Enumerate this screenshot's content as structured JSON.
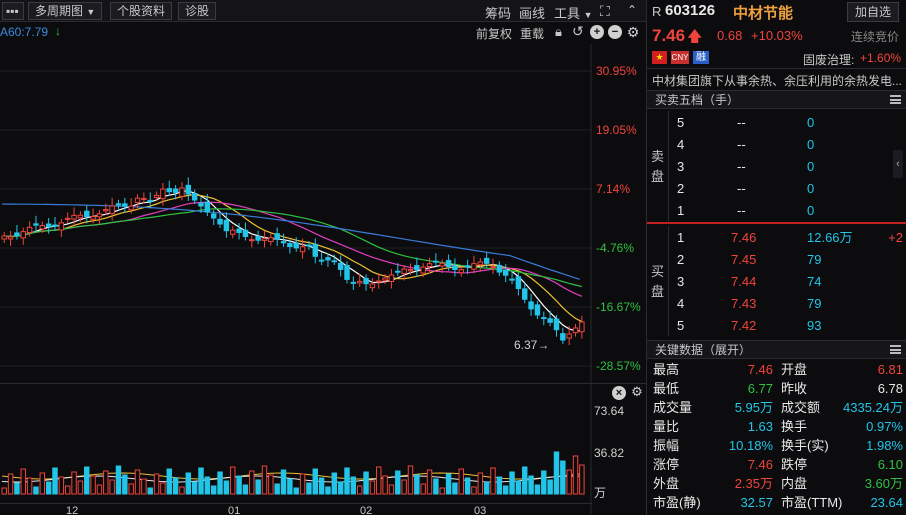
{
  "toolbar": {
    "period_label": "多周期图",
    "stock_info_label": "个股资料",
    "diagnose_label": "诊股",
    "chips_label": "筹码",
    "draw_label": "画线",
    "tools_label": "工具"
  },
  "ma_readout": "A60:7.79",
  "chart_controls": {
    "fq_label": "前复权",
    "overlay_label": "重载"
  },
  "price_axis": {
    "labels": [
      "30.95%",
      "19.05%",
      "7.14%",
      "-4.76%",
      "-16.67%",
      "-28.57%"
    ]
  },
  "min_marker": "6.37→",
  "volume_axis": {
    "labels": [
      "73.64",
      "36.82",
      "万"
    ]
  },
  "time_axis": {
    "labels": [
      "12",
      "01",
      "02",
      "03"
    ]
  },
  "stock": {
    "prefix": "R",
    "code": "603126",
    "name": "中材节能",
    "add_watch": "加自选",
    "price": "7.46",
    "change": "0.68",
    "change_pct": "+10.03%",
    "auction": "连续竞价",
    "badges": [
      "CNY",
      "融"
    ],
    "theme_label": "固废治理:",
    "theme_pct": "+1.60%",
    "description": "中材集团旗下从事余热、余压利用的余热发电..."
  },
  "order_book": {
    "title": "买卖五档（手）",
    "sell_label": "卖盘",
    "buy_label": "买盘",
    "sells": [
      {
        "level": "5",
        "price": "--",
        "vol": "0"
      },
      {
        "level": "4",
        "price": "--",
        "vol": "0"
      },
      {
        "level": "3",
        "price": "--",
        "vol": "0"
      },
      {
        "level": "2",
        "price": "--",
        "vol": "0"
      },
      {
        "level": "1",
        "price": "--",
        "vol": "0"
      }
    ],
    "buys": [
      {
        "level": "1",
        "price": "7.46",
        "vol": "12.66万",
        "delta": "+2"
      },
      {
        "level": "2",
        "price": "7.45",
        "vol": "79",
        "delta": ""
      },
      {
        "level": "3",
        "price": "7.44",
        "vol": "74",
        "delta": ""
      },
      {
        "level": "4",
        "price": "7.43",
        "vol": "79",
        "delta": ""
      },
      {
        "level": "5",
        "price": "7.42",
        "vol": "93",
        "delta": ""
      }
    ]
  },
  "key_data": {
    "title": "关键数据（展开）",
    "rows": [
      {
        "l1": "最高",
        "v1": "7.46",
        "l2": "开盘",
        "v2": "6.81"
      },
      {
        "l1": "最低",
        "v1": "6.77",
        "l2": "昨收",
        "v2": "6.78"
      },
      {
        "l1": "成交量",
        "v1": "5.95万",
        "l2": "成交额",
        "v2": "4335.24万"
      },
      {
        "l1": "量比",
        "v1": "1.63",
        "l2": "换手",
        "v2": "0.97%"
      },
      {
        "l1": "振幅",
        "v1": "10.18%",
        "l2": "换手(实)",
        "v2": "1.98%"
      },
      {
        "l1": "涨停",
        "v1": "7.46",
        "l2": "跌停",
        "v2": "6.10"
      },
      {
        "l1": "外盘",
        "v1": "2.35万",
        "l2": "内盘",
        "v2": "3.60万"
      },
      {
        "l1": "市盈(静)",
        "v1": "32.57",
        "l2": "市盈(TTM)",
        "v2": "23.64"
      }
    ]
  },
  "colors": {
    "up": "#f0443c",
    "down": "#22c4e8",
    "ma5": "#ffffff",
    "ma10": "#f0c030",
    "ma20": "#e040c0",
    "ma30": "#30c040",
    "ma60": "#3a7ad8"
  },
  "chart_data": {
    "type": "candlestick",
    "series": [
      {
        "name": "A60",
        "values": [
          7.79
        ]
      }
    ],
    "yticks_pct": [
      "30.95%",
      "19.05%",
      "7.14%",
      "-4.76%",
      "-16.67%",
      "-28.57%"
    ],
    "x_tick_labels": [
      "12",
      "01",
      "02",
      "03"
    ],
    "min_price": 6.37,
    "volume_ticks": [
      "73.64",
      "36.82"
    ]
  }
}
